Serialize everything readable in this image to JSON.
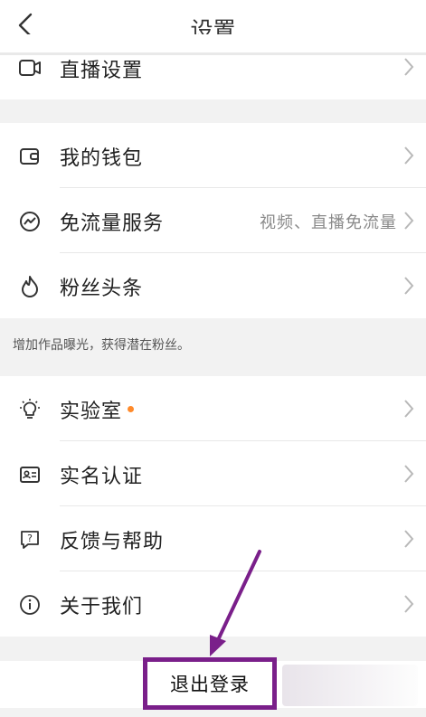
{
  "header": {
    "title": "设置"
  },
  "groups": {
    "live": {
      "label": "直播设置"
    },
    "wallet": {
      "label": "我的钱包"
    },
    "free_traffic": {
      "label": "免流量服务",
      "value": "视频、直播免流量"
    },
    "fans_headline": {
      "label": "粉丝头条"
    },
    "fans_note": "增加作品曝光，获得潜在粉丝。",
    "lab": {
      "label": "实验室"
    },
    "realname": {
      "label": "实名认证"
    },
    "feedback": {
      "label": "反馈与帮助"
    },
    "about": {
      "label": "关于我们"
    }
  },
  "logout": {
    "label": "退出登录"
  },
  "colors": {
    "accent_dot": "#ff8a2b",
    "highlight_box": "#7a1f8a",
    "arrow": "#7a1f8a"
  },
  "icons": [
    "back-icon",
    "video-icon",
    "wallet-icon",
    "traffic-icon",
    "flame-icon",
    "bulb-icon",
    "id-card-icon",
    "help-icon",
    "info-icon",
    "chevron-right-icon"
  ]
}
